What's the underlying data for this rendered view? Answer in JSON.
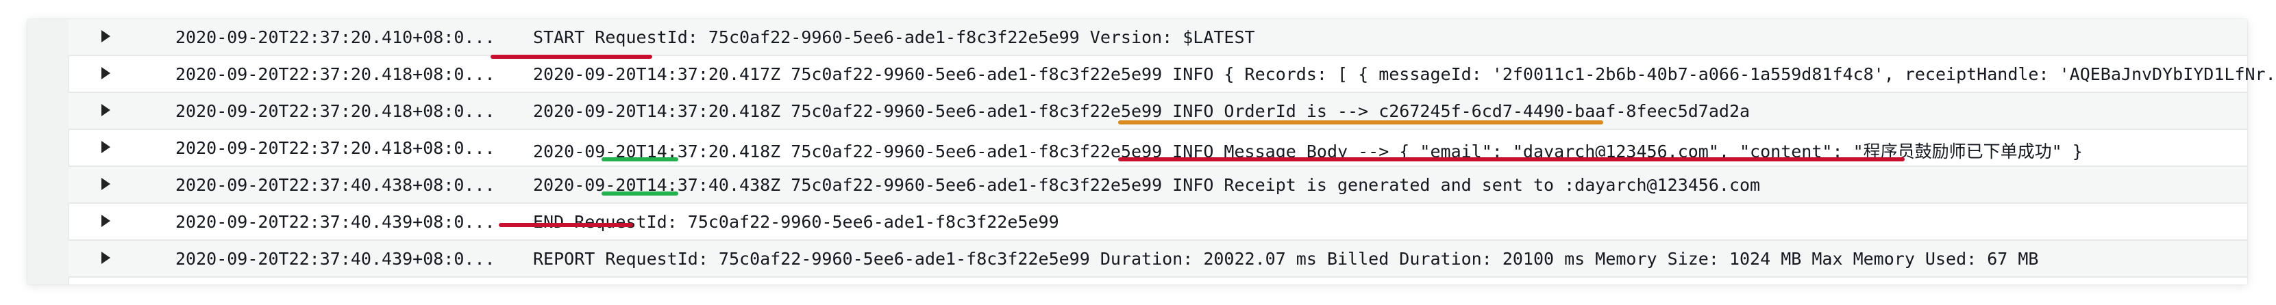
{
  "log_events": [
    {
      "timestamp": "2020-09-20T22:37:20.410+08:0...",
      "message": "START RequestId: 75c0af22-9960-5ee6-ade1-f8c3f22e5e99 Version: $LATEST"
    },
    {
      "timestamp": "2020-09-20T22:37:20.418+08:0...",
      "message": "2020-09-20T14:37:20.417Z 75c0af22-9960-5ee6-ade1-f8c3f22e5e99 INFO { Records: [ { messageId: '2f0011c1-2b6b-40b7-a066-1a559d81f4c8', receiptHandle: 'AQEBaJnvDYbIYD1LfNr..."
    },
    {
      "timestamp": "2020-09-20T22:37:20.418+08:0...",
      "message": "2020-09-20T14:37:20.418Z 75c0af22-9960-5ee6-ade1-f8c3f22e5e99 INFO OrderId is --> c267245f-6cd7-4490-baaf-8feec5d7ad2a"
    },
    {
      "timestamp": "2020-09-20T22:37:20.418+08:0...",
      "message": "2020-09-20T14:37:20.418Z 75c0af22-9960-5ee6-ade1-f8c3f22e5e99 INFO Message Body --> { \"email\": \"dayarch@123456.com\", \"content\": \"程序员鼓励师已下单成功\" }"
    },
    {
      "timestamp": "2020-09-20T22:37:40.438+08:0...",
      "message": "2020-09-20T14:37:40.438Z 75c0af22-9960-5ee6-ade1-f8c3f22e5e99 INFO Receipt is generated and sent to :dayarch@123456.com"
    },
    {
      "timestamp": "2020-09-20T22:37:40.439+08:0...",
      "message": "END RequestId: 75c0af22-9960-5ee6-ade1-f8c3f22e5e99"
    },
    {
      "timestamp": "2020-09-20T22:37:40.439+08:0...",
      "message": "REPORT RequestId: 75c0af22-9960-5ee6-ade1-f8c3f22e5e99 Duration: 20022.07 ms Billed Duration: 20100 ms Memory Size: 1024 MB Max Memory Used: 67 MB"
    }
  ],
  "annotation_colors": {
    "red": "#c8102e",
    "orange": "#d98b1f",
    "green": "#22b14c"
  },
  "icons": {
    "expand_toggle": "caret-right-icon"
  }
}
